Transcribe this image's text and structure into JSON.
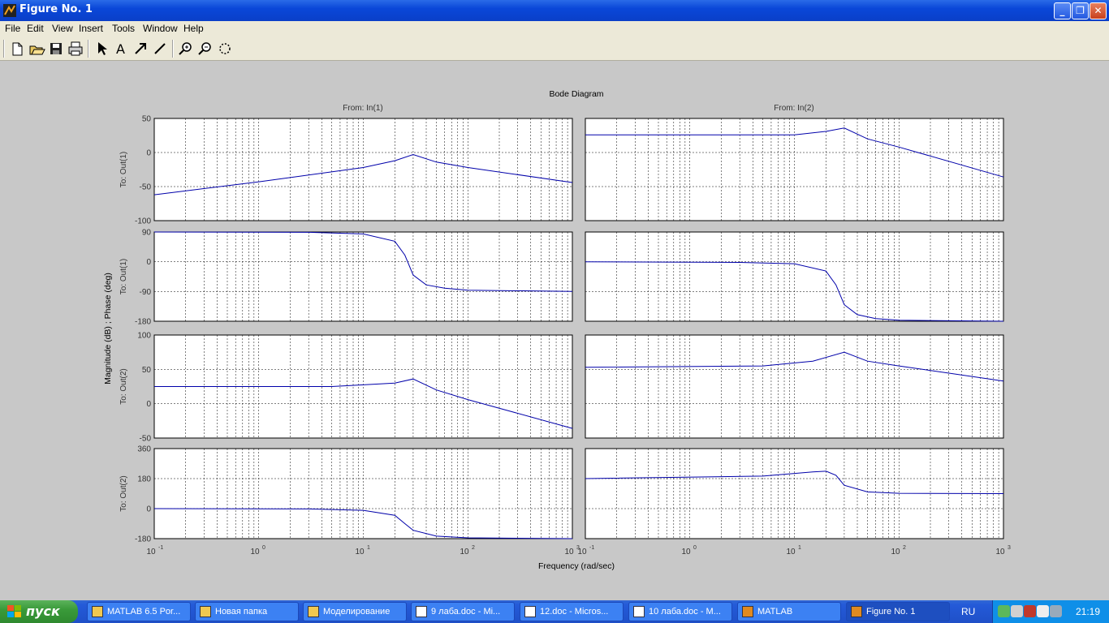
{
  "window": {
    "title": "Figure No. 1"
  },
  "menu": [
    "File",
    "Edit",
    "View",
    "Insert",
    "Tools",
    "Window",
    "Help"
  ],
  "toolbar": {
    "icons": [
      "new-figure-icon",
      "open-file-icon",
      "save-icon",
      "print-icon",
      "select-arrow-icon",
      "insert-text-icon",
      "insert-arrow-icon",
      "insert-line-icon",
      "zoom-in-icon",
      "zoom-out-icon",
      "rotate-3d-icon"
    ]
  },
  "figure": {
    "title": "Bode Diagram",
    "xlabel": "Frequency  (rad/sec)",
    "ylabel": "Magnitude (dB) ; Phase (deg)",
    "col_titles": [
      "From: In(1)",
      "From: In(2)"
    ],
    "row_labels": [
      "To: Out(1)",
      "To: Out(1)",
      "To: Out(2)",
      "To: Out(2)"
    ],
    "x_ticks": [
      "10",
      "10",
      "10",
      "10",
      "10"
    ],
    "x_tick_exps": [
      "-1",
      "0",
      "1",
      "2",
      "3"
    ]
  },
  "chart_data": {
    "type": "line",
    "title": "Bode Diagram",
    "xlabel": "Frequency  (rad/sec)",
    "ylabel": "Magnitude (dB) ; Phase (deg)",
    "xscale": "log",
    "xlim": [
      0.1,
      1000
    ],
    "grid": true,
    "line_color": "#0000aa",
    "panels": [
      {
        "row": 0,
        "col": 0,
        "kind": "magnitude",
        "ylim": [
          -100,
          50
        ],
        "yticks": [
          "50",
          "0",
          "-50",
          "-100"
        ],
        "points": [
          [
            0.1,
            -62
          ],
          [
            1,
            -43
          ],
          [
            10,
            -22
          ],
          [
            20,
            -12
          ],
          [
            30,
            -3
          ],
          [
            50,
            -14
          ],
          [
            100,
            -22
          ],
          [
            1000,
            -44
          ]
        ]
      },
      {
        "row": 0,
        "col": 1,
        "kind": "magnitude",
        "ylim": [
          -100,
          50
        ],
        "yticks": [],
        "points": [
          [
            0.1,
            26
          ],
          [
            10,
            26
          ],
          [
            20,
            31
          ],
          [
            30,
            36
          ],
          [
            50,
            20
          ],
          [
            100,
            8
          ],
          [
            1000,
            -36
          ]
        ]
      },
      {
        "row": 1,
        "col": 0,
        "kind": "phase",
        "ylim": [
          -180,
          90
        ],
        "yticks": [
          "90",
          "0",
          "-90",
          "-180"
        ],
        "points": [
          [
            0.1,
            90
          ],
          [
            3,
            89
          ],
          [
            10,
            84
          ],
          [
            20,
            62
          ],
          [
            25,
            20
          ],
          [
            30,
            -40
          ],
          [
            40,
            -70
          ],
          [
            60,
            -80
          ],
          [
            100,
            -86
          ],
          [
            1000,
            -90
          ]
        ]
      },
      {
        "row": 1,
        "col": 1,
        "kind": "phase",
        "ylim": [
          -180,
          90
        ],
        "yticks": [],
        "points": [
          [
            0.1,
            0
          ],
          [
            3,
            -2
          ],
          [
            10,
            -6
          ],
          [
            20,
            -28
          ],
          [
            25,
            -70
          ],
          [
            30,
            -130
          ],
          [
            40,
            -160
          ],
          [
            60,
            -172
          ],
          [
            100,
            -177
          ],
          [
            1000,
            -180
          ]
        ]
      },
      {
        "row": 2,
        "col": 0,
        "kind": "magnitude",
        "ylim": [
          -50,
          100
        ],
        "yticks": [
          "100",
          "50",
          "0",
          "-50"
        ],
        "points": [
          [
            0.1,
            25
          ],
          [
            5,
            25
          ],
          [
            20,
            30
          ],
          [
            30,
            36
          ],
          [
            50,
            20
          ],
          [
            100,
            6
          ],
          [
            1000,
            -36
          ]
        ]
      },
      {
        "row": 2,
        "col": 1,
        "kind": "magnitude",
        "ylim": [
          -50,
          100
        ],
        "yticks": [],
        "points": [
          [
            0.1,
            53
          ],
          [
            5,
            55
          ],
          [
            15,
            62
          ],
          [
            30,
            75
          ],
          [
            50,
            62
          ],
          [
            100,
            55
          ],
          [
            1000,
            33
          ]
        ]
      },
      {
        "row": 3,
        "col": 0,
        "kind": "phase",
        "ylim": [
          -180,
          360
        ],
        "yticks": [
          "360",
          "180",
          "0",
          "-180"
        ],
        "points": [
          [
            0.1,
            0
          ],
          [
            3,
            -2
          ],
          [
            10,
            -10
          ],
          [
            20,
            -40
          ],
          [
            25,
            -90
          ],
          [
            30,
            -130
          ],
          [
            50,
            -165
          ],
          [
            100,
            -175
          ],
          [
            1000,
            -180
          ]
        ]
      },
      {
        "row": 3,
        "col": 1,
        "kind": "phase",
        "ylim": [
          -180,
          360
        ],
        "yticks": [],
        "points": [
          [
            0.1,
            180
          ],
          [
            5,
            195
          ],
          [
            15,
            220
          ],
          [
            20,
            225
          ],
          [
            25,
            200
          ],
          [
            30,
            140
          ],
          [
            50,
            100
          ],
          [
            100,
            92
          ],
          [
            1000,
            90
          ]
        ]
      }
    ]
  },
  "taskbar": {
    "start": "пуск",
    "tasks": [
      "MATLAB 6.5 Por...",
      "Новая папка",
      "Моделирование",
      "9 лаба.doc - Mi...",
      "12.doc - Micros...",
      "10 лаба.doc - M...",
      "MATLAB",
      "Figure No. 1"
    ],
    "language": "RU",
    "clock": "21:19"
  }
}
